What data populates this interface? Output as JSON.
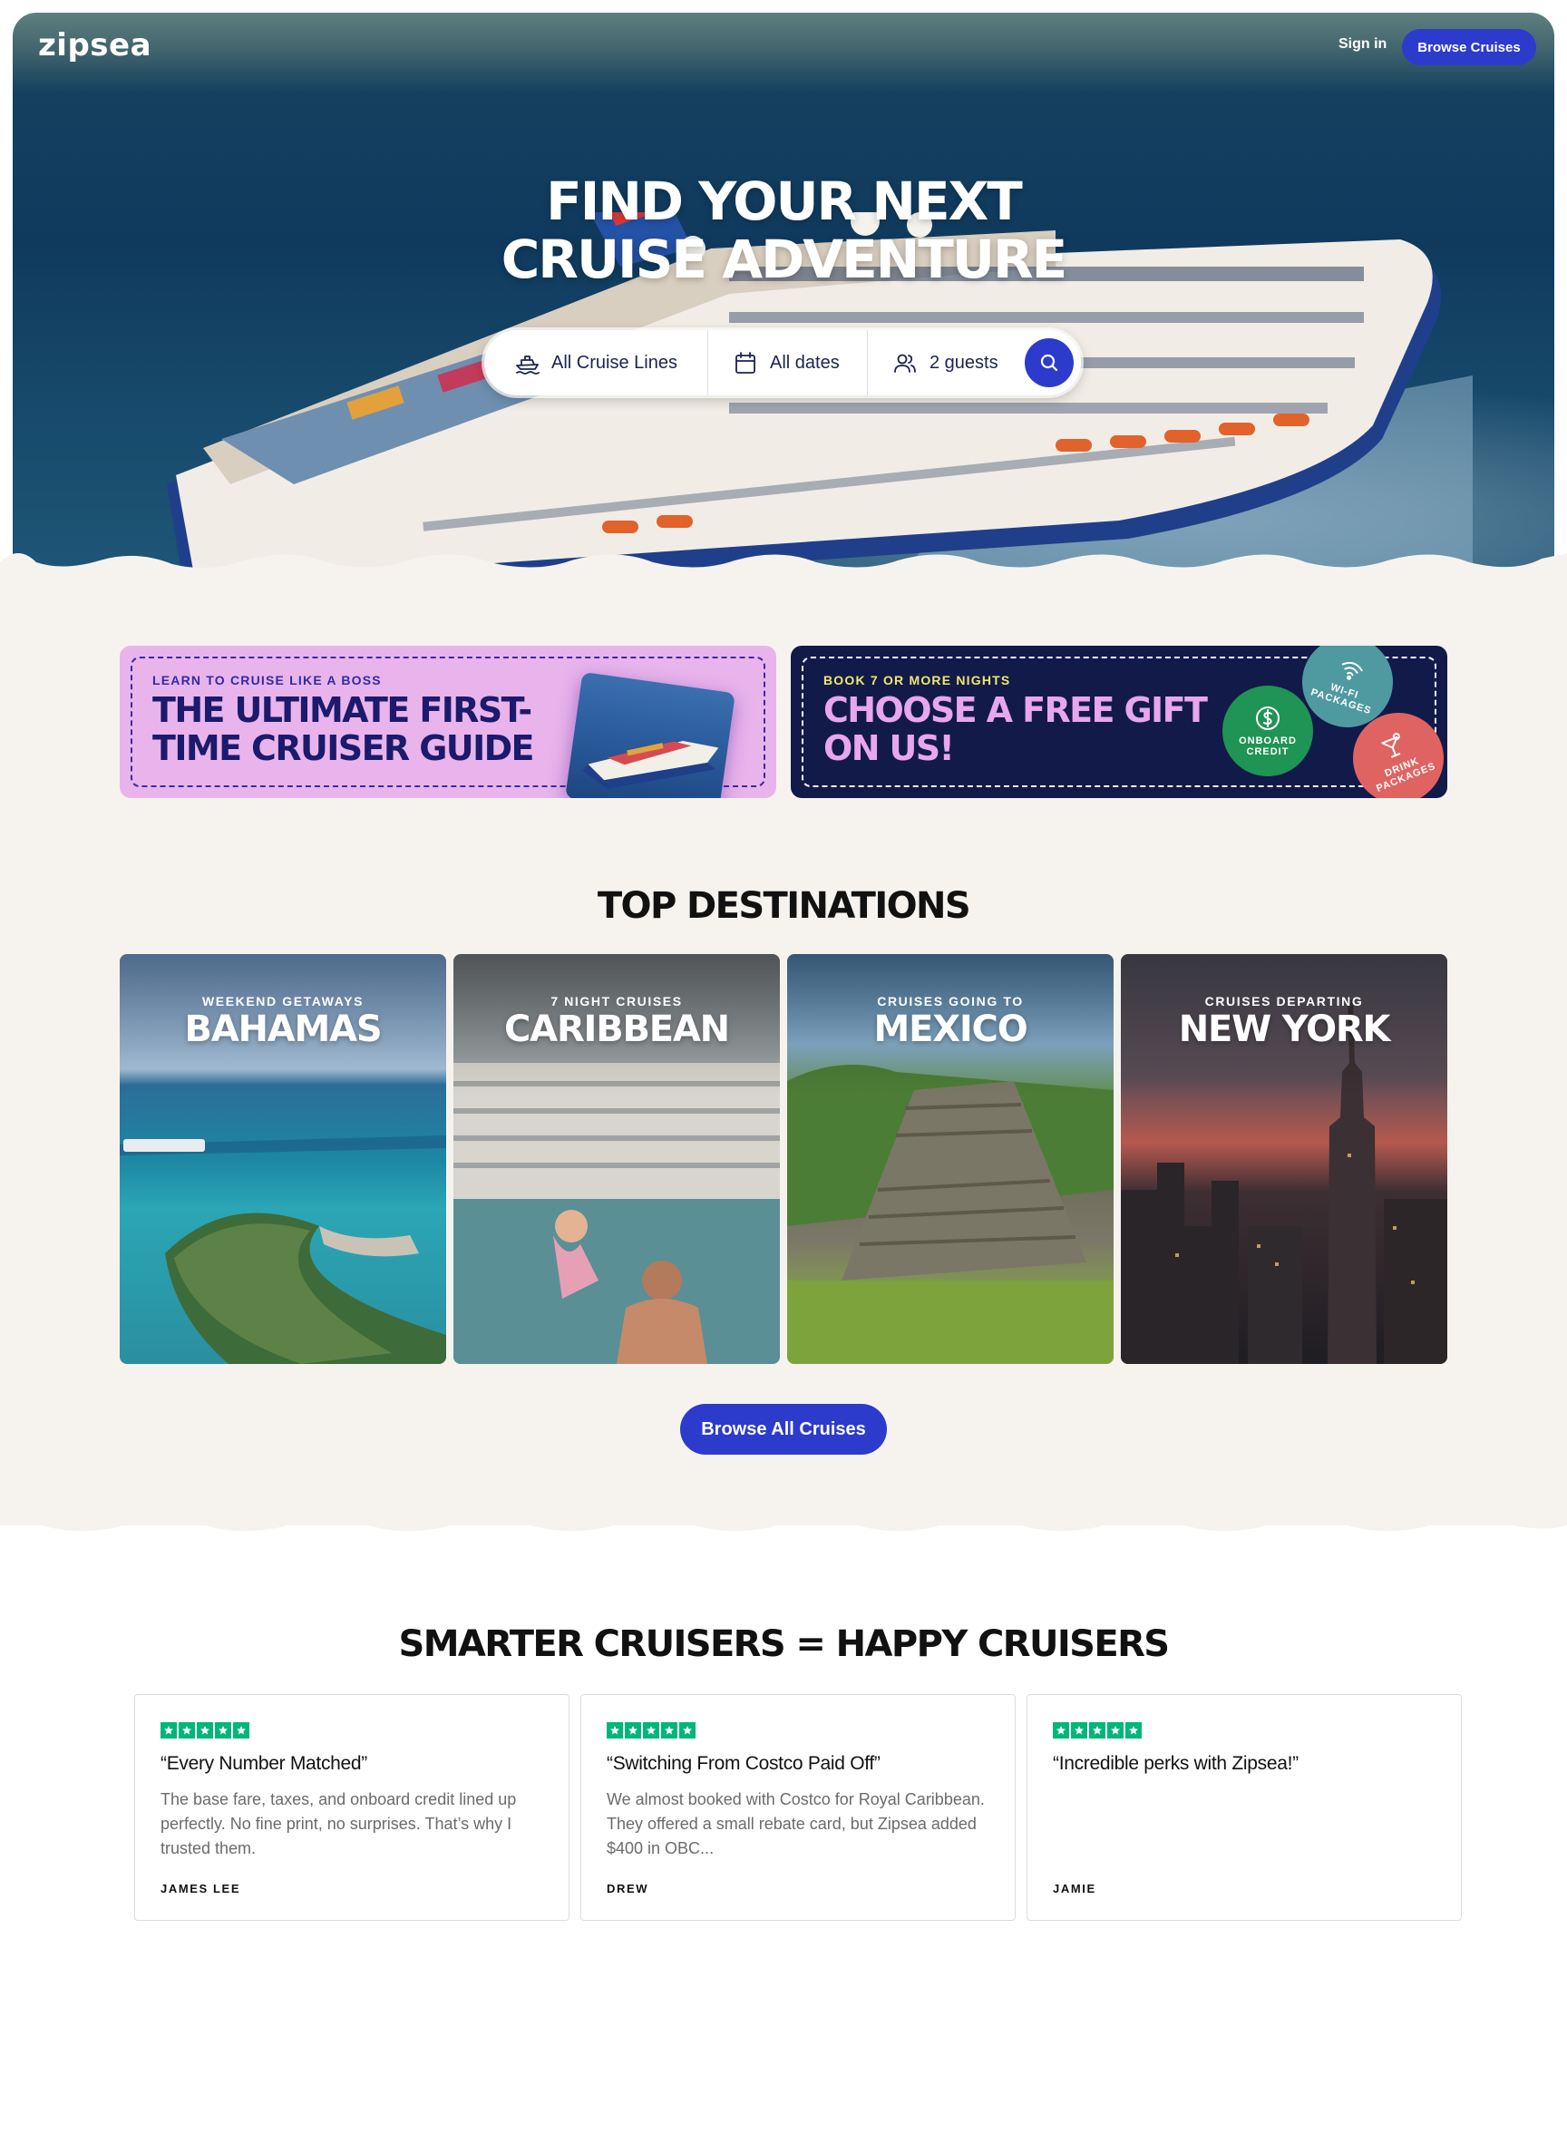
{
  "header": {
    "logo": "zipsea",
    "signin": "Sign in",
    "browse_button": "Browse Cruises"
  },
  "hero": {
    "title_line1": "FIND YOUR NEXT",
    "title_line2": "CRUISE ADVENTURE",
    "search": {
      "cruise_lines": "All Cruise Lines",
      "dates": "All dates",
      "guests": "2 guests"
    }
  },
  "promos": {
    "guide": {
      "kicker": "LEARN TO CRUISE LIKE A BOSS",
      "headline": "THE ULTIMATE FIRST-TIME CRUISER GUIDE"
    },
    "gift": {
      "kicker": "BOOK 7 OR MORE NIGHTS",
      "headline": "CHOOSE A FREE GIFT ON US!",
      "badges": {
        "wifi": "WI-FI PACKAGES",
        "obc": "ONBOARD CREDIT",
        "drink": "DRINK PACKAGES"
      }
    }
  },
  "destinations": {
    "title": "TOP DESTINATIONS",
    "cards": [
      {
        "kicker": "WEEKEND GETAWAYS",
        "name": "BAHAMAS"
      },
      {
        "kicker": "7 NIGHT CRUISES",
        "name": "CARIBBEAN"
      },
      {
        "kicker": "CRUISES GOING TO",
        "name": "MEXICO"
      },
      {
        "kicker": "CRUISES DEPARTING",
        "name": "NEW YORK"
      }
    ],
    "browse_all": "Browse All Cruises"
  },
  "reviews": {
    "title": "SMARTER CRUISERS = HAPPY CRUISERS",
    "items": [
      {
        "rating": 5,
        "headline": "“Every Number Matched”",
        "body": "The base fare, taxes, and onboard credit lined up perfectly. No fine print, no surprises. That’s why I trusted them.",
        "author": "JAMES LEE"
      },
      {
        "rating": 5,
        "headline": "“Switching From Costco Paid Off”",
        "body": "We almost booked with Costco for Royal Caribbean. They offered a small rebate card, but Zipsea added $400 in OBC...",
        "author": "DREW"
      },
      {
        "rating": 5,
        "headline": "“Incredible perks with Zipsea!”",
        "body": "",
        "author": "JAMIE"
      }
    ]
  },
  "colors": {
    "brand_blue": "#2c3bcc",
    "beige": "#f6f3ee",
    "promo_pink": "#e9b4ec",
    "promo_navy": "#121a4a",
    "star_green": "#00b67a"
  }
}
